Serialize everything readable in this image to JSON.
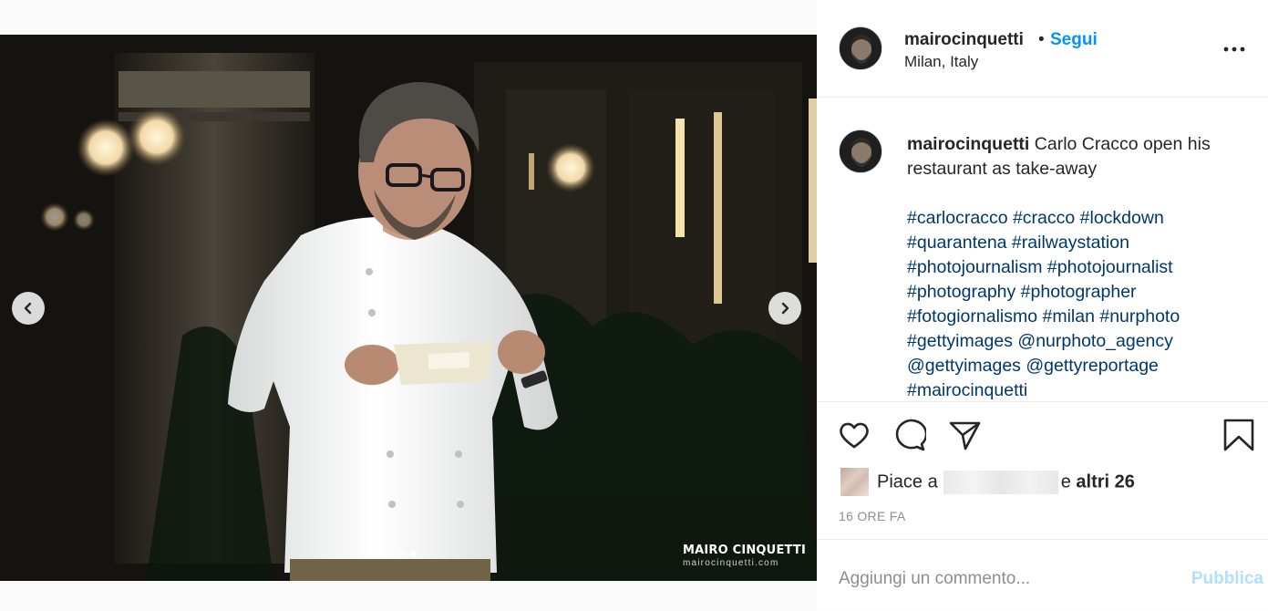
{
  "post": {
    "username": "mairocinquetti",
    "separator": "•",
    "follow_label": "Segui",
    "location": "Milan, Italy",
    "more_icon": "more-horizontal-icon"
  },
  "media": {
    "watermark_name": "MAIRO CINQUETTI",
    "watermark_url": "mairocinquetti.com",
    "carousel_total": 3,
    "carousel_active_index": 3
  },
  "caption": {
    "username": "mairocinquetti",
    "text": "Carlo Cracco open his restaurant as take-away",
    "tags_line1": "#carlocracco #cracco #lockdown",
    "tags_line2": "#quarantena #railwaystation",
    "tags_line3": "#photojournalism #photojournalist",
    "tags_line4": "#photography #photographer",
    "tags_line5": "#fotogiornalismo #milan #nurphoto",
    "tags_line6": "#gettyimages @nurphoto_agency",
    "tags_line7": "@gettyimages @gettyreportage",
    "tags_line8": "#mairocinquetti"
  },
  "likes": {
    "prefix": "Piace a",
    "connector": "e",
    "others": "altri 26"
  },
  "timestamp": "16 ORE FA",
  "comment": {
    "placeholder": "Aggiungi un commento...",
    "publish_label": "Pubblica"
  },
  "colors": {
    "accent": "#0095f6",
    "hashtag": "#00376b",
    "publish_disabled": "#b2dffc",
    "muted": "#8e8e8e"
  }
}
